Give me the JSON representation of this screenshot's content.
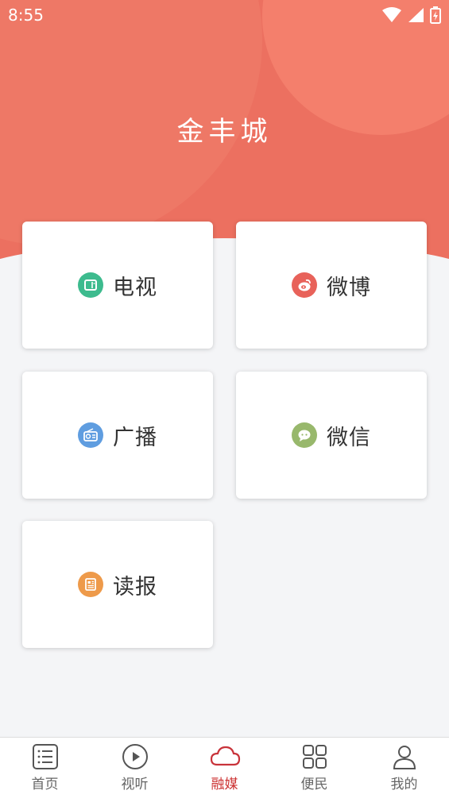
{
  "status_bar": {
    "time": "8:55"
  },
  "header": {
    "title": "金丰城"
  },
  "cards": [
    {
      "label": "电视",
      "icon": "tv-icon",
      "color": "#3dbb8e"
    },
    {
      "label": "微博",
      "icon": "weibo-icon",
      "color": "#e8625a"
    },
    {
      "label": "广播",
      "icon": "radio-icon",
      "color": "#5f9de0"
    },
    {
      "label": "微信",
      "icon": "wechat-icon",
      "color": "#98b86c"
    },
    {
      "label": "读报",
      "icon": "newspaper-icon",
      "color": "#ee9a4a"
    }
  ],
  "tabbar": {
    "active_index": 2,
    "active_color": "#c8333a",
    "items": [
      {
        "label": "首页",
        "icon": "list-icon"
      },
      {
        "label": "视听",
        "icon": "play-circle-icon"
      },
      {
        "label": "融媒",
        "icon": "cloud-icon"
      },
      {
        "label": "便民",
        "icon": "grid-icon"
      },
      {
        "label": "我的",
        "icon": "user-icon"
      }
    ]
  }
}
